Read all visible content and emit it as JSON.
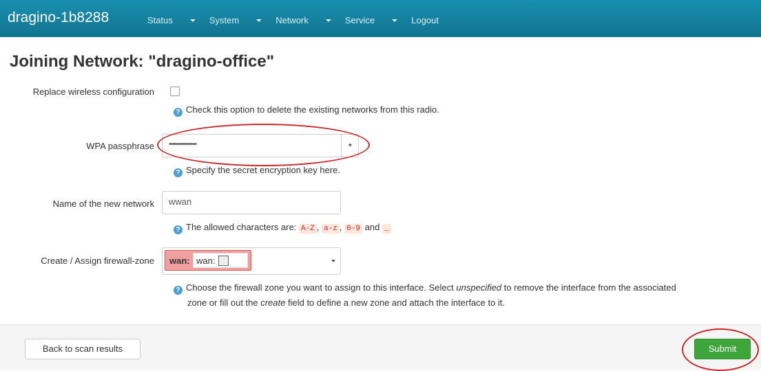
{
  "header": {
    "brand": "dragino-1b8288",
    "menu": [
      {
        "label": "Status",
        "dropdown": true
      },
      {
        "label": "System",
        "dropdown": true
      },
      {
        "label": "Network",
        "dropdown": true
      },
      {
        "label": "Service",
        "dropdown": true
      },
      {
        "label": "Logout",
        "dropdown": false
      }
    ]
  },
  "page": {
    "title": "Joining Network: \"dragino-office\""
  },
  "form": {
    "replace": {
      "label": "Replace wireless configuration",
      "checked": false,
      "help": "Check this option to delete the existing networks from this radio."
    },
    "wpa": {
      "label": "WPA passphrase",
      "value": "••••••••••••••",
      "reveal_glyph": "*",
      "help": "Specify the secret encryption key here."
    },
    "name": {
      "label": "Name of the new network",
      "value": "wwan",
      "help_prefix": "The allowed characters are:",
      "chars": [
        "A-Z",
        "a-z",
        "0-9",
        "_"
      ],
      "sep": ",",
      "and": "and"
    },
    "zone": {
      "label": "Create / Assign firewall-zone",
      "zone_name": "wan:",
      "zone_iface": "wan:",
      "help_line1_a": "Choose the firewall zone you want to assign to this interface. Select ",
      "help_line1_em": "unspecified",
      "help_line1_b": " to remove the interface from the associated",
      "help_line2_a": "zone or fill out the ",
      "help_line2_em": "create",
      "help_line2_b": " field to define a new zone and attach the interface to it."
    }
  },
  "footer": {
    "back_label": "Back to scan results",
    "submit_label": "Submit"
  },
  "colors": {
    "navbar": "#1283a4",
    "submit": "#3ea53a",
    "highlight_ring": "#c62828",
    "zone_badge": "#f0a0a0"
  }
}
